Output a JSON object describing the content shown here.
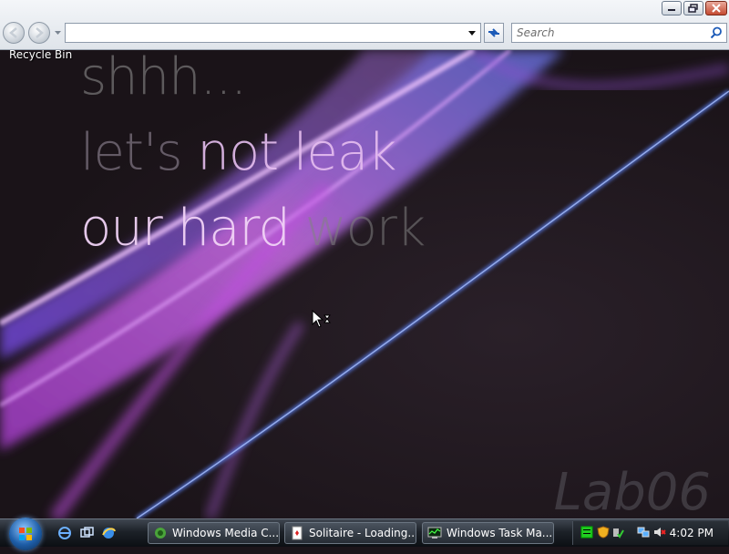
{
  "browser": {
    "address_value": "",
    "search_placeholder": "Search"
  },
  "desktop": {
    "recycle_bin_label": "Recycle Bin",
    "headline": {
      "line1": "shhh...",
      "line2_a": "let's ",
      "line2_b": "not leak",
      "line3_a": "our hard ",
      "line3_b": "work"
    },
    "watermark": "Lab06"
  },
  "taskbar": {
    "tasks": [
      {
        "label": "Windows Media C...",
        "icon": "media-center-icon"
      },
      {
        "label": "Solitaire - Loading...",
        "icon": "solitaire-icon"
      },
      {
        "label": "Windows Task Ma...",
        "icon": "task-manager-icon"
      }
    ],
    "clock": "4:02 PM"
  },
  "colors": {
    "accent_purple": "#c060e0",
    "accent_blue": "#6090ff",
    "taskbar": "#1c2128"
  }
}
